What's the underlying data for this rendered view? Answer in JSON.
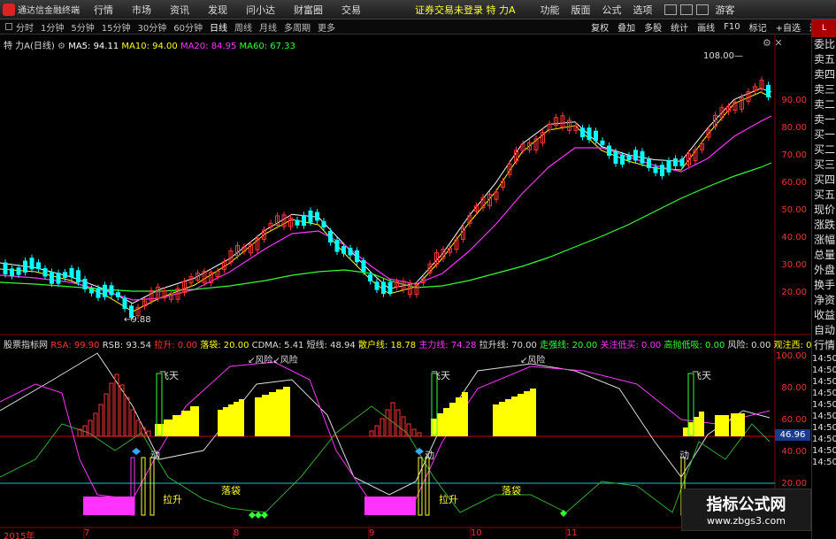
{
  "menubar": {
    "app_title": "通达信金融终端",
    "items": [
      "行情",
      "市场",
      "资讯",
      "发现",
      "问小达",
      "财富圈",
      "交易"
    ],
    "warning": "证券交易未登录",
    "stock": "特 力A",
    "right_items": [
      "功能",
      "版面",
      "公式",
      "选项"
    ],
    "guest": "游客"
  },
  "periodbar": {
    "items": [
      "分时",
      "1分钟",
      "5分钟",
      "15分钟",
      "30分钟",
      "60分钟",
      "日线",
      "周线",
      "月线",
      "多周期",
      "更多"
    ],
    "active_index": 6,
    "right_buttons": [
      "复权",
      "叠加",
      "多股",
      "统计",
      "画线",
      "F10",
      "标记",
      "+自选",
      "返回"
    ]
  },
  "main_legend": {
    "name": "特 力A",
    "period": "(日线)",
    "items": [
      {
        "label": "MA5: 94.11",
        "color": "#ffffff"
      },
      {
        "label": "MA10: 94.00",
        "color": "#ffff00"
      },
      {
        "label": "MA20: 84.95",
        "color": "#ff33ff"
      },
      {
        "label": "MA60: 67.33",
        "color": "#33ff33"
      }
    ]
  },
  "main_ticks": [
    "90.00",
    "80.00",
    "70.00",
    "60.00",
    "50.00",
    "40.00",
    "30.00",
    "20.00"
  ],
  "main_annotations": {
    "high": "108.00",
    "low": "9.88"
  },
  "ind_legend": {
    "name": "股票指标网",
    "items": [
      {
        "label": "RSA: 99.90",
        "color": "#ff3333"
      },
      {
        "label": "RSB: 93.54",
        "color": "#dddddd"
      },
      {
        "label": "拉升: 0.00",
        "color": "#ff3333"
      },
      {
        "label": "落袋: 20.00",
        "color": "#ffff00"
      },
      {
        "label": "CDMA: 5.41",
        "color": "#dddddd"
      },
      {
        "label": "短线: 48.94",
        "color": "#dddddd"
      },
      {
        "label": "散户线: 18.78",
        "color": "#ffff00"
      },
      {
        "label": "主力线: 74.28",
        "color": "#ff33ff"
      },
      {
        "label": "拉升线: 70.00",
        "color": "#dddddd"
      },
      {
        "label": "走强线: 20.00",
        "color": "#33ff33"
      },
      {
        "label": "关注低买: 0.00",
        "color": "#ff33ff"
      },
      {
        "label": "高抛低吸: 0.00",
        "color": "#33ff33"
      },
      {
        "label": "风险: 0.00",
        "color": "#dddddd"
      },
      {
        "label": "观注西: 0.0",
        "color": "#ffff00"
      }
    ]
  },
  "ind_ticks": [
    "100.00",
    "80.00",
    "60.00",
    "40.00",
    "20.00"
  ],
  "ind_value_badge": "46.96",
  "ind_labels": {
    "fly": "飞天",
    "risk": "风险",
    "dong": "动",
    "lasheng": "拉升",
    "luodai": "落袋"
  },
  "date_axis": [
    "2015年",
    "7",
    "8",
    "9",
    "10",
    "11"
  ],
  "right_col": [
    "委比",
    "卖五",
    "卖四",
    "卖三",
    "卖二",
    "卖一",
    "买一",
    "买二",
    "买三",
    "买四",
    "买五",
    "现价",
    "涨跌",
    "涨幅",
    "总量",
    "外盘",
    "换手",
    "净资",
    "收益",
    "自动",
    "行情",
    "14:50",
    "14:50",
    "14:50",
    "14:50",
    "14:50",
    "14:50",
    "14:50",
    "14:50",
    "14:50",
    "14:50"
  ],
  "watermark": {
    "title": "指标公式网",
    "url": "www.zbgs3.com"
  },
  "colors": {
    "up": "#ff3333",
    "down": "#00ffff",
    "ma5": "#ffffff",
    "ma10": "#ffff00",
    "ma20": "#ff33ff",
    "ma60": "#33ff33"
  }
}
